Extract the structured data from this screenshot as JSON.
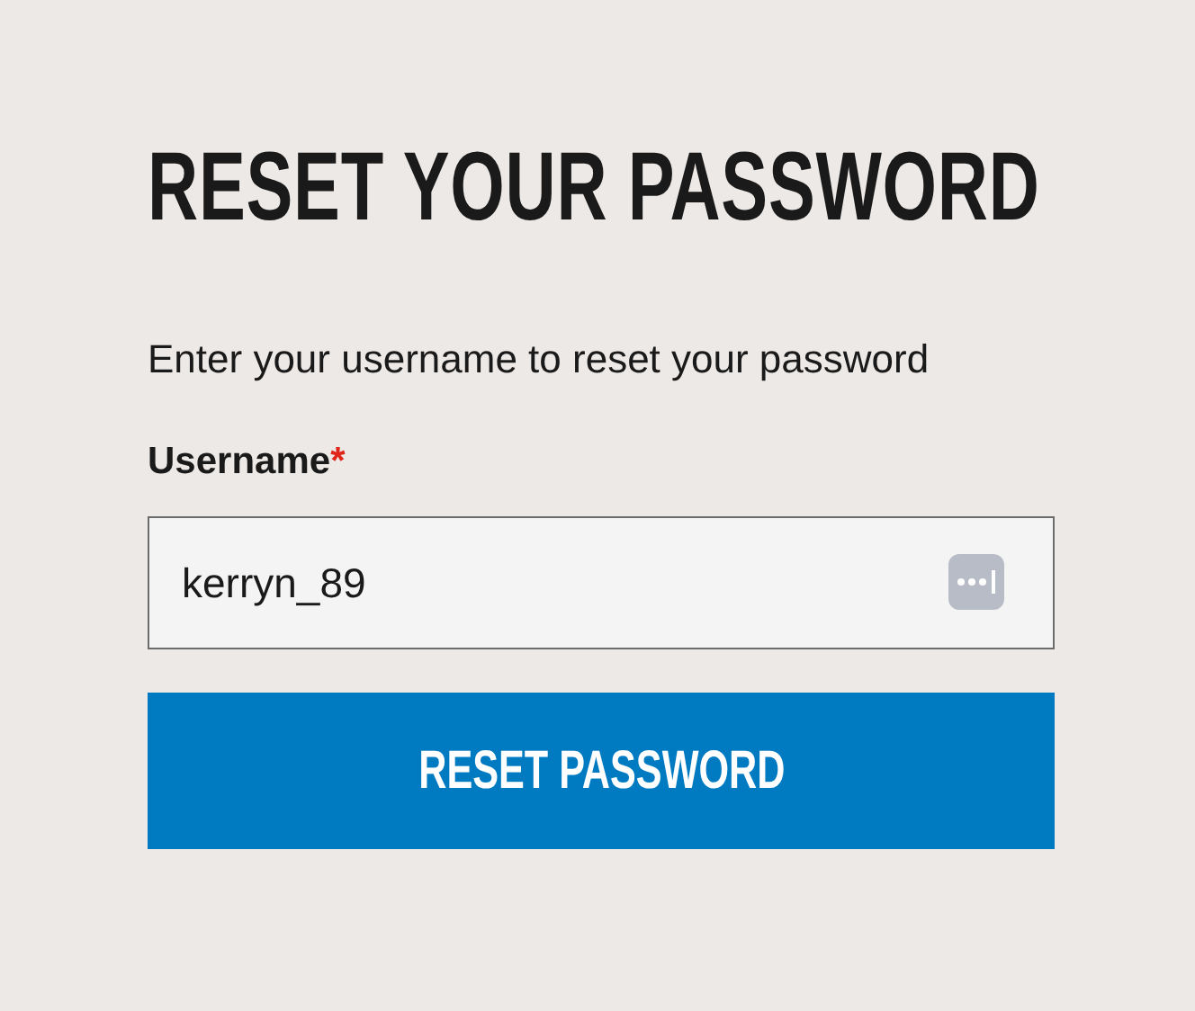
{
  "heading": "RESET YOUR PASSWORD",
  "instructions": "Enter your username to reset your password",
  "username_field": {
    "label": "Username",
    "required_marker": "*",
    "value": "kerryn_89"
  },
  "submit_button": {
    "label": "RESET PASSWORD"
  }
}
